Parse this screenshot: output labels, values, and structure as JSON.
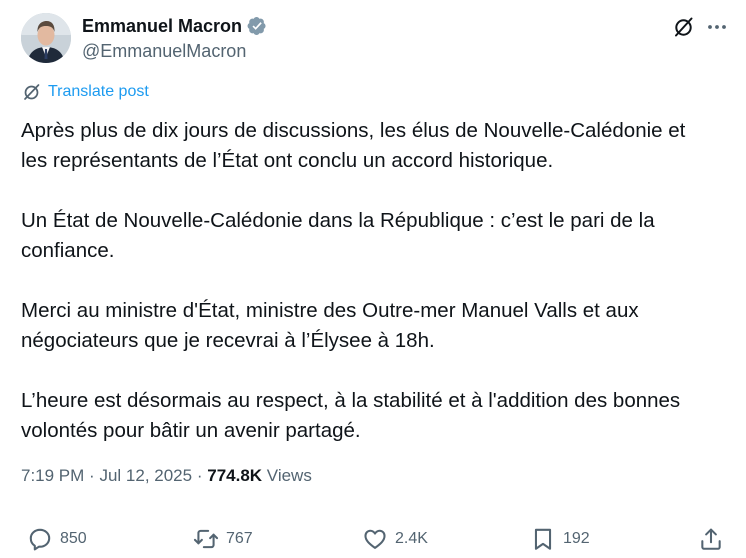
{
  "author": {
    "display_name": "Emmanuel Macron",
    "handle": "@EmmanuelMacron",
    "verified": true,
    "avatar": "avatar-portrait"
  },
  "header_icons": {
    "grok": "grok-icon",
    "more": "more-icon"
  },
  "translate": {
    "icon": "translate-icon",
    "label": "Translate post"
  },
  "post": {
    "paragraphs": [
      "Après plus de dix jours de discussions, les élus de Nouvelle-Calédonie et\nles représentants de l’État ont conclu un accord historique.",
      "Un État de Nouvelle-Calédonie dans la République : c’est le pari de la\nconfiance.",
      "Merci au ministre d'État, ministre des Outre-mer Manuel Valls et aux\nnégociateurs que je recevrai à l’Élysee à 18h.",
      "L’heure est désormais au respect, à la stabilité et à l'addition des bonnes\nvolontés pour bâtir un avenir partagé."
    ]
  },
  "meta": {
    "time": "7:19 PM",
    "separator": "·",
    "date": "Jul 12, 2025",
    "views_count": "774.8K",
    "views_label": "Views"
  },
  "actions": {
    "replies": {
      "icon": "reply-icon",
      "count": "850"
    },
    "reposts": {
      "icon": "repost-icon",
      "count": "767"
    },
    "likes": {
      "icon": "heart-icon",
      "count": "2.4K"
    },
    "bookmarks": {
      "icon": "bookmark-icon",
      "count": "192"
    },
    "share": {
      "icon": "share-icon"
    }
  },
  "colors": {
    "text": "#0f1419",
    "secondary": "#536471",
    "link": "#1d9bf0",
    "verified": "#829aab"
  }
}
